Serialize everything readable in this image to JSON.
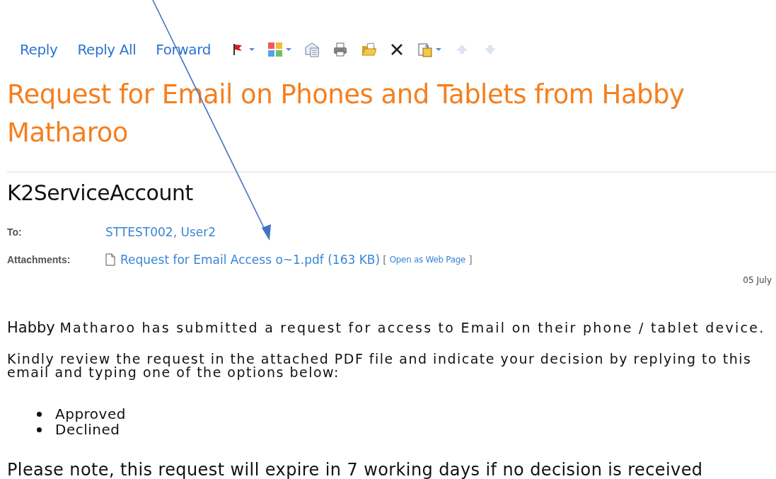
{
  "toolbar": {
    "actions": [
      "Reply",
      "Reply All",
      "Forward"
    ],
    "tools": [
      {
        "kind": "flag",
        "dropdown": true,
        "disabled": false
      },
      {
        "kind": "categories",
        "dropdown": true,
        "disabled": false
      },
      {
        "kind": "envelope",
        "dropdown": false,
        "disabled": false
      },
      {
        "kind": "printer",
        "dropdown": false,
        "disabled": false
      },
      {
        "kind": "folder",
        "dropdown": false,
        "disabled": false
      },
      {
        "kind": "delete",
        "dropdown": false,
        "disabled": false
      },
      {
        "kind": "paste",
        "dropdown": true,
        "disabled": false
      },
      {
        "kind": "up",
        "dropdown": false,
        "disabled": true
      },
      {
        "kind": "down",
        "dropdown": false,
        "disabled": true
      }
    ]
  },
  "subject": "Request for Email on Phones and Tablets from Habby Matharoo",
  "sender": "K2ServiceAccount",
  "to": {
    "label": "To:",
    "value": "STTEST002, User2"
  },
  "attachments": {
    "label": "Attachments:",
    "file": "Request for Email Access o~1.pdf (163 KB)",
    "open_link": "Open as Web Page",
    "bracket_open": "[",
    "bracket_close": "]"
  },
  "date": "05 July",
  "body": {
    "intro_first": "Habby",
    "intro_rest": "Matharoo has submitted a request for access to Email on their phone / tablet device.",
    "instruction": "Kindly review the request in the attached PDF file and indicate your decision by replying to this email and typing one of the options below:",
    "options": [
      "Approved",
      "Declined"
    ],
    "note": "Please note, this request will expire in 7 working days if no decision is received"
  }
}
